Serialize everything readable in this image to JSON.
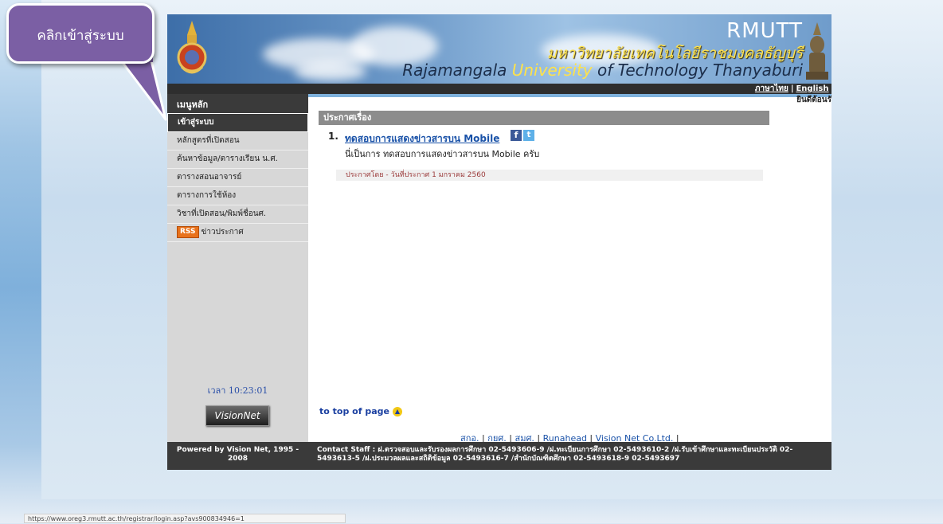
{
  "banner": {
    "rmutt": "RMUTT",
    "thai_name": "มหาวิทยาลัยเทคโนโลยีราชมงคลธัญบุรี",
    "eng_name_pre": "Rajamangala ",
    "eng_name_hl": "University",
    "eng_name_post": " of Technology Thanyaburi"
  },
  "langbar": {
    "thai": "ภาษาไทย",
    "sep": "|",
    "english": "English"
  },
  "sidebar": {
    "header": "เมนูหลัก",
    "items": [
      {
        "label": "เข้าสู่ระบบ",
        "active": true
      },
      {
        "label": "หลักสูตรที่เปิดสอน"
      },
      {
        "label": "ค้นหาข้อมูล/ตารางเรียน น.ศ."
      },
      {
        "label": "ตารางสอนอาจารย์"
      },
      {
        "label": "ตารางการใช้ห้อง"
      },
      {
        "label": "วิชาที่เปิดสอน/พิมพ์ชื่อนศ."
      },
      {
        "label": "ข่าวประกาศ",
        "badge": "RSS"
      }
    ],
    "clock": "เวลา 10:23:01",
    "logo": "VisionNet"
  },
  "main": {
    "welcome": "ยินดีต้อนรั",
    "announcement_header": "ประกาศเรื่อง",
    "item_number": "1.",
    "item_title": "ทดสอบการแสดงข่าวสารบน Mobile",
    "item_desc": "นี่เป็นการ ทดสอบการแสดงข่าวสารบน Mobile ครับ",
    "item_meta": "ประกาศโดย  -  วันที่ประกาศ  1 มกราคม 2560",
    "fb": "f",
    "tw": "t",
    "totop": "to top of page",
    "links": [
      "สกอ.",
      "กยศ.",
      "สมศ.",
      "Runahead",
      "Vision Net Co.Ltd."
    ]
  },
  "footer": {
    "powered": "Powered by Vision Net, 1995 - 2008",
    "contact": "Contact Staff : ฝ.ตรวจสอบและรับรองผลการศึกษา 02-5493606-9 /ฝ.ทะเบียนการศึกษา 02-5493610-2 /ฝ.รับเข้าศึกษาและทะเบียนประวัติ 02-5493613-5 /ฝ.ประมวลผลและสถิติข้อมูล 02-5493616-7 /สำนักบัณฑิตศึกษา 02-5493618-9 02-5493697"
  },
  "status_url": "https://www.oreg3.rmutt.ac.th/registrar/login.asp?avs900834946=1",
  "callout": "คลิกเข้าสู่ระบบ"
}
